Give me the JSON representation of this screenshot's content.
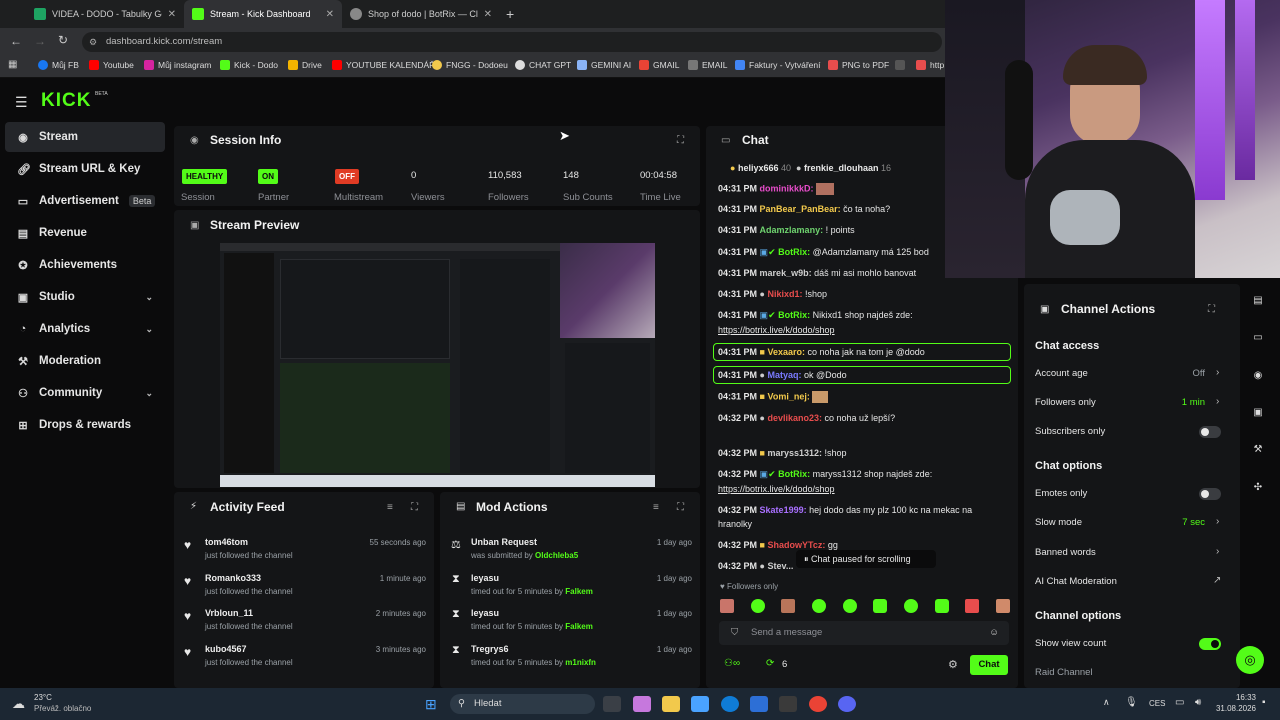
{
  "browser": {
    "tabs": [
      {
        "label": "VIDEA - DODO - Tabulky Goog"
      },
      {
        "label": "Stream - Kick Dashboard"
      },
      {
        "label": "Shop of dodo | BotRix — Cloud"
      }
    ],
    "url": "dashboard.kick.com/stream",
    "bookmarks": [
      "Můj FB",
      "Youtube",
      "Můj instagram",
      "Kick - Dodo",
      "Drive",
      "YOUTUBE KALENDÁŘ",
      "FNGG - Dodoeu",
      "CHAT GPT",
      "GEMINI AI",
      "GMAIL",
      "EMAIL",
      "Faktury - Vytváření",
      "PNG to PDF",
      "http"
    ]
  },
  "brand": {
    "logo": "KICK",
    "beta": "BETA",
    "accent": "#53fc18"
  },
  "sidebar": {
    "items": [
      {
        "label": "Stream"
      },
      {
        "label": "Stream URL & Key"
      },
      {
        "label": "Advertisement",
        "badge": "Beta"
      },
      {
        "label": "Revenue"
      },
      {
        "label": "Achievements"
      },
      {
        "label": "Studio"
      },
      {
        "label": "Analytics"
      },
      {
        "label": "Moderation"
      },
      {
        "label": "Community"
      },
      {
        "label": "Drops & rewards"
      }
    ]
  },
  "session": {
    "title": "Session Info",
    "stats": [
      {
        "badge": "HEALTHY",
        "label": "Session"
      },
      {
        "badge": "ON",
        "label": "Partner"
      },
      {
        "badge": "OFF",
        "label": "Multistream"
      },
      {
        "value": "0",
        "label": "Viewers"
      },
      {
        "value": "110,583",
        "label": "Followers"
      },
      {
        "value": "148",
        "label": "Sub Counts"
      },
      {
        "value": "00:04:58",
        "label": "Time Live"
      }
    ]
  },
  "preview": {
    "title": "Stream Preview"
  },
  "activity": {
    "title": "Activity Feed",
    "items": [
      {
        "name": "tom46tom",
        "sub": "just followed the channel",
        "time": "55 seconds ago"
      },
      {
        "name": "Romanko333",
        "sub": "just followed the channel",
        "time": "1 minute ago"
      },
      {
        "name": "Vrbloun_11",
        "sub": "just followed the channel",
        "time": "2 minutes ago"
      },
      {
        "name": "kubo4567",
        "sub": "just followed the channel",
        "time": "3 minutes ago"
      }
    ]
  },
  "mod": {
    "title": "Mod Actions",
    "items": [
      {
        "name": "Unban Request",
        "sub": "was submitted by ",
        "who": "Oldchleba5",
        "time": "1 day ago"
      },
      {
        "name": "leyasu",
        "sub": "timed out for 5 minutes by ",
        "who": "Falkem",
        "time": "1 day ago"
      },
      {
        "name": "leyasu",
        "sub": "timed out for 5 minutes by ",
        "who": "Falkem",
        "time": "1 day ago"
      },
      {
        "name": "Tregrys6",
        "sub": "timed out for 5 minutes by ",
        "who": "m1nixfn",
        "time": "1 day ago"
      }
    ]
  },
  "chat": {
    "title": "Chat",
    "top": [
      {
        "name": "heliyx666",
        "n": "40"
      },
      {
        "name": "frenkie_dlouhaan",
        "n": "16"
      }
    ],
    "lines": [
      {
        "t": "04:31 PM",
        "u": "dominikkkD:",
        "c": "#e84dcb",
        "m": ""
      },
      {
        "t": "04:31 PM",
        "u": "PanBear_PanBear:",
        "c": "#f2c94c",
        "m": " čo ta noha?"
      },
      {
        "t": "04:31 PM",
        "u": "Adamzlamany:",
        "c": "#6fd36f",
        "m": " ! points"
      },
      {
        "t": "04:31 PM",
        "u": "BotRix:",
        "c": "#53fc18",
        "m": " @Adamzlamany má 125 bod"
      },
      {
        "t": "04:31 PM",
        "u": "marek_w9b:",
        "c": "#cfcfcf",
        "m": " dáš mi asi mohlo banovat"
      },
      {
        "t": "04:31 PM",
        "u": "Nikixd1:",
        "c": "#e84d4d",
        "m": " !shop"
      },
      {
        "t": "04:31 PM",
        "u": "BotRix:",
        "c": "#53fc18",
        "m": " Nikixd1 shop najdeš zde:"
      },
      {
        "t": "",
        "u": "",
        "c": "#fff",
        "m": "https://botrix.live/k/dodo/shop"
      },
      {
        "t": "04:31 PM",
        "u": "Vexaaro:",
        "c": "#f2c94c",
        "m": " co noha jak na tom je @dodo"
      },
      {
        "t": "04:31 PM",
        "u": "Matyaq:",
        "c": "#7a7aff",
        "m": " ok @Dodo"
      },
      {
        "t": "04:31 PM",
        "u": "Vomi_nej:",
        "c": "#f2c94c",
        "m": ""
      },
      {
        "t": "04:32 PM",
        "u": "devlikano23:",
        "c": "#e84d4d",
        "m": " co noha už lepší?"
      },
      {
        "t": "04:32 PM",
        "u": "maryss1312:",
        "c": "#cfcfcf",
        "m": " !shop"
      },
      {
        "t": "04:32 PM",
        "u": "BotRix:",
        "c": "#53fc18",
        "m": " maryss1312 shop najdeš zde:"
      },
      {
        "t": "",
        "u": "",
        "c": "#fff",
        "m": "https://botrix.live/k/dodo/shop"
      },
      {
        "t": "04:32 PM",
        "u": "Skate1999:",
        "c": "#a970ff",
        "m": " hej dodo das my plz 100 kc na mekac na"
      },
      {
        "t": "",
        "u": "",
        "c": "#fff",
        "m": "hranolky"
      },
      {
        "t": "04:32 PM",
        "u": "ShadowYTcz:",
        "c": "#e84d4d",
        "m": " gg"
      },
      {
        "t": "04:32 PM",
        "u": "Stev...",
        "c": "#cfcfcf",
        "m": ""
      }
    ],
    "paused": "Chat paused for scrolling",
    "followers_only": "Followers only",
    "placeholder": "Send a message",
    "count": "6",
    "send": "Chat"
  },
  "actions": {
    "title": "Channel Actions",
    "access_head": "Chat access",
    "access": [
      {
        "label": "Account age",
        "value": "Off"
      },
      {
        "label": "Followers only",
        "value": "1 min"
      },
      {
        "label": "Subscribers only",
        "value": ""
      }
    ],
    "options_head": "Chat options",
    "options": [
      {
        "label": "Emotes only"
      },
      {
        "label": "Slow mode",
        "value": "7 sec"
      },
      {
        "label": "Banned words"
      },
      {
        "label": "AI Chat Moderation"
      }
    ],
    "channel_head": "Channel options",
    "channel": [
      {
        "label": "Show view count"
      },
      {
        "label": "Raid Channel"
      }
    ]
  },
  "taskbar": {
    "weather_temp": "23°C",
    "weather_desc": "Převáž. oblačno",
    "search": "Hledat",
    "lang": "CES",
    "time": "16:33",
    "date": "31.08.2026"
  }
}
